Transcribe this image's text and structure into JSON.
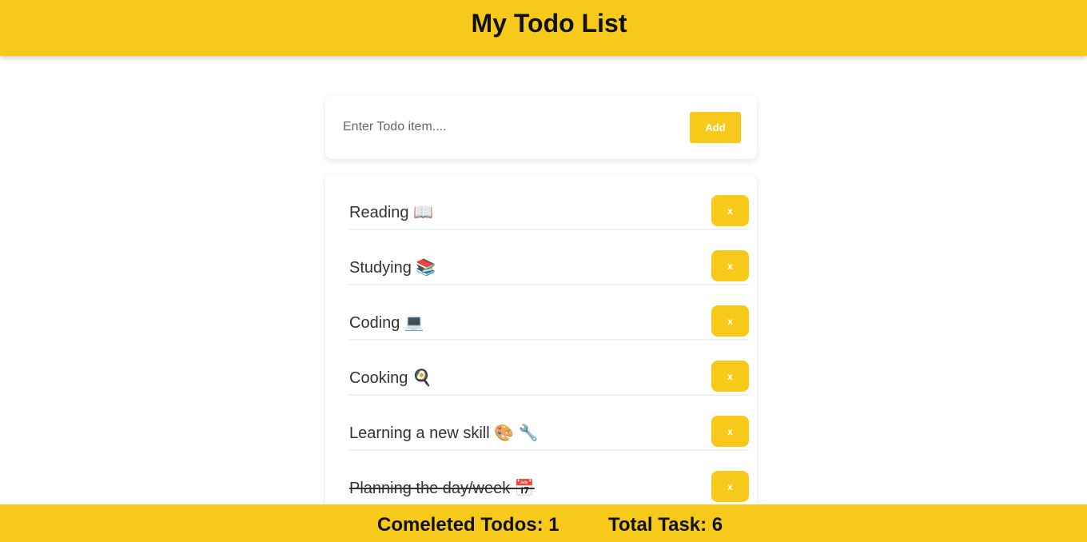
{
  "header": {
    "title": "My Todo List"
  },
  "input": {
    "placeholder": "Enter Todo item....",
    "value": "",
    "add_label": "Add"
  },
  "todos": [
    {
      "text": "Reading 📖",
      "delete_label": "x",
      "completed": false
    },
    {
      "text": "Studying 📚",
      "delete_label": "x",
      "completed": false
    },
    {
      "text": "Coding 💻",
      "delete_label": "x",
      "completed": false
    },
    {
      "text": "Cooking 🍳",
      "delete_label": "x",
      "completed": false
    },
    {
      "text": "Learning a new skill 🎨 🔧",
      "delete_label": "x",
      "completed": false
    },
    {
      "text": "Planning the day/week 📅",
      "delete_label": "x",
      "completed": true
    }
  ],
  "footer": {
    "completed_label": "Comeleted Todos: 1",
    "total_label": "Total Task: 6"
  },
  "colors": {
    "accent": "#f6c91a",
    "text": "#333333",
    "heading": "#111111"
  }
}
